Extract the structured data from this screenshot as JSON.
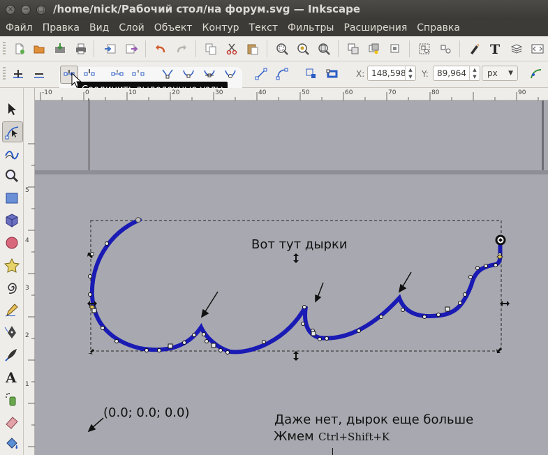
{
  "window": {
    "title": "/home/nick/Рабочий стол/на форум.svg — Inkscape",
    "buttons": {
      "close": "×",
      "minimize": "−",
      "maximize": "□"
    }
  },
  "menu": [
    "Файл",
    "Правка",
    "Вид",
    "Слой",
    "Объект",
    "Контур",
    "Текст",
    "Фильтры",
    "Расширения",
    "Справка"
  ],
  "commands_toolbar": {
    "icons": [
      "new-document-icon",
      "open-icon",
      "save-icon",
      "print-icon",
      "import-icon",
      "export-icon",
      "undo-icon",
      "redo-icon",
      "copy-icon",
      "cut-icon",
      "paste-icon",
      "zoom-selection-icon",
      "zoom-drawing-icon",
      "zoom-page-icon",
      "duplicate-icon",
      "clone-icon",
      "unlink-clone-icon",
      "group-icon",
      "ungroup-icon",
      "fill-stroke-icon",
      "text-font-icon",
      "layers-icon",
      "xml-editor-icon"
    ]
  },
  "node_toolbar": {
    "icons": [
      "insert-node-icon",
      "delete-node-icon",
      "join-nodes-icon",
      "break-node-icon",
      "join-segment-icon",
      "delete-segment-icon",
      "node-cusp-icon",
      "node-smooth-icon",
      "node-symmetric-icon",
      "node-auto-icon",
      "segment-line-icon",
      "segment-curve-icon",
      "object-to-path-icon",
      "stroke-to-path-icon",
      "path-effect-icon"
    ],
    "x_label": "X:",
    "x_value": "148,598",
    "y_label": "Y:",
    "y_value": "89,964",
    "unit": "px",
    "tooltip": "Соединить выделенные узлы"
  },
  "tools": [
    "selector-tool-icon",
    "node-tool-icon",
    "tweak-tool-icon",
    "zoom-tool-icon",
    "rectangle-tool-icon",
    "3d-box-tool-icon",
    "ellipse-tool-icon",
    "star-tool-icon",
    "spiral-tool-icon",
    "pencil-tool-icon",
    "pen-tool-icon",
    "calligraphy-tool-icon",
    "text-tool-icon",
    "spray-tool-icon",
    "eraser-tool-icon",
    "paint-bucket-tool-icon"
  ],
  "rulers": {
    "horizontal": [
      "-10",
      "0",
      "10",
      "20",
      "30",
      "40",
      "50",
      "60",
      "70",
      "80",
      "90"
    ],
    "vertical": [
      "5",
      "4",
      "3",
      "2",
      "1"
    ]
  },
  "canvas": {
    "annotation_holes": "Вот тут дырки",
    "annotation_coords": "(0.0; 0.0; 0.0)",
    "annotation_more": "Даже нет, дырок еще больше",
    "annotation_press": "Жмем",
    "annotation_shortcut": "Ctrl+Shift+K",
    "path_color": "#1a1ab4"
  }
}
